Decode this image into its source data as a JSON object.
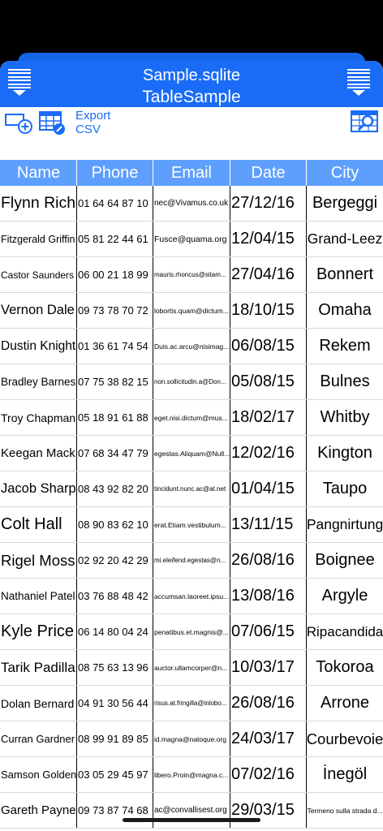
{
  "header": {
    "file": "Sample.sqlite",
    "table": "TableSample"
  },
  "toolbar": {
    "export_label_1": "Export",
    "export_label_2": "CSV"
  },
  "columns": [
    "Name",
    "Phone",
    "Email",
    "Date",
    "City"
  ],
  "rows": [
    [
      "Flynn Rich",
      "01 64 64 87 10",
      "nec@Vivamus.co.uk",
      "27/12/16",
      "Bergeggi"
    ],
    [
      "Fitzgerald Griffin",
      "05 81 22 44 61",
      "Fusce@quama.org",
      "12/04/15",
      "Grand-Leez"
    ],
    [
      "Castor Saunders",
      "06 00 21 18 99",
      "mauris.rhoncus@sitam...",
      "27/04/16",
      "Bonnert"
    ],
    [
      "Vernon Dale",
      "09 73 78 70 72",
      "lobortis.quam@dictum...",
      "18/10/15",
      "Omaha"
    ],
    [
      "Dustin Knight",
      "01 36 61 74 54",
      "Duis.ac.arcu@nisimag...",
      "06/08/15",
      "Rekem"
    ],
    [
      "Bradley Barnes",
      "07 75 38 82 15",
      "non.sollicitudin.a@Don...",
      "05/08/15",
      "Bulnes"
    ],
    [
      "Troy Chapman",
      "05 18 91 61 88",
      "eget.nisi.dictum@mus...",
      "18/02/17",
      "Whitby"
    ],
    [
      "Keegan Mack",
      "07 68 34 47 79",
      "egestas.Aliquam@Null...",
      "12/02/16",
      "Kington"
    ],
    [
      "Jacob Sharp",
      "08 43 92 82 20",
      "tincidunt.nunc.ac@at.net",
      "01/04/15",
      "Taupo"
    ],
    [
      "Colt Hall",
      "08 90 83 62 10",
      "erat.Etiam.vestibulum...",
      "13/11/15",
      "Pangnirtung"
    ],
    [
      "Rigel Moss",
      "02 92 20 42 29",
      "mi.eleifend.egestas@n...",
      "26/08/16",
      "Boignee"
    ],
    [
      "Nathaniel Patel",
      "03 76 88 48 42",
      "accumsan.laoreet.ipsu...",
      "13/08/16",
      "Argyle"
    ],
    [
      "Kyle Price",
      "06 14 80 04 24",
      "penatibus.et.magnis@...",
      "07/06/15",
      "Ripacandida"
    ],
    [
      "Tarik Padilla",
      "08 75 63 13 96",
      "auctor.ullamcorper@n...",
      "10/03/17",
      "Tokoroa"
    ],
    [
      "Dolan Bernard",
      "04 91 30 56 44",
      "risus.at.fringilla@inlobo...",
      "26/08/16",
      "Arrone"
    ],
    [
      "Curran Gardner",
      "08 99 91 89 85",
      "id.magna@natoque.org",
      "24/03/17",
      "Courbevoie"
    ],
    [
      "Samson Golden",
      "03 05 29 45 97",
      "libero.Proin@magna.c...",
      "07/02/16",
      "İnegöl"
    ],
    [
      "Gareth Payne",
      "09 73 87 74 68",
      "ac@convallisest.org",
      "29/03/15",
      "Termeno sulla strada d..."
    ]
  ],
  "colors": {
    "header": "#1a6cf6",
    "table_head": "#5e9ffd"
  },
  "icons": [
    "menu-icon",
    "add-record-icon",
    "edit-table-icon",
    "search-table-icon"
  ]
}
